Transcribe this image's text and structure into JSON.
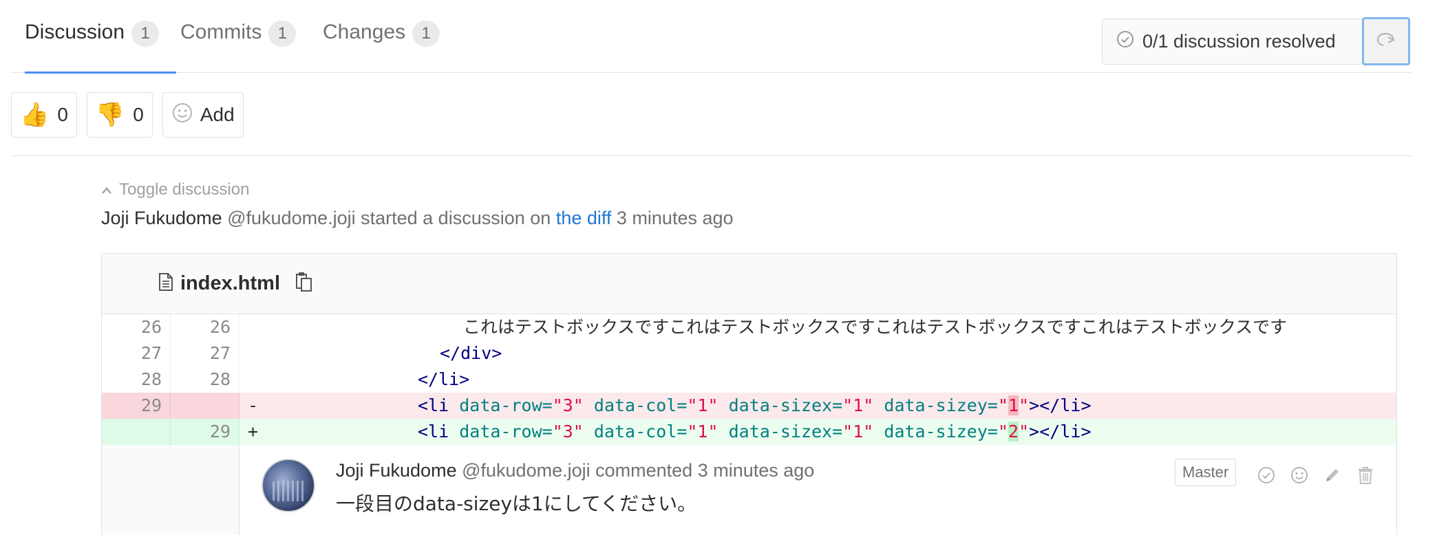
{
  "tabs": [
    {
      "label": "Discussion",
      "count": "1",
      "active": true
    },
    {
      "label": "Commits",
      "count": "1",
      "active": false
    },
    {
      "label": "Changes",
      "count": "1",
      "active": false
    }
  ],
  "resolved": {
    "text": "0/1 discussion resolved",
    "icon": "check-circle-icon"
  },
  "jump_button": {
    "icon": "comment-arrow-icon"
  },
  "awards": [
    {
      "emoji": "👍",
      "icon": "thumbs-up-icon",
      "count": "0"
    },
    {
      "emoji": "👎",
      "icon": "thumbs-down-icon",
      "count": "0"
    },
    {
      "icon": "smiley-icon",
      "label": "Add"
    }
  ],
  "discussion": {
    "toggle_label": "Toggle discussion",
    "author": "Joji Fukudome",
    "handle": "@fukudome.joji",
    "action": "started a discussion on",
    "link": "the diff",
    "time": "3 minutes ago"
  },
  "file": {
    "name": "index.html",
    "lines": [
      {
        "old": "26",
        "new": "26",
        "sign": "",
        "text": "これはテストボックスですこれはテストボックスですこれはテストボックスですこれはテストボックスです"
      },
      {
        "old": "27",
        "new": "27",
        "sign": "",
        "text": "</div>"
      },
      {
        "old": "28",
        "new": "28",
        "sign": "",
        "text": "</li>"
      },
      {
        "old": "29",
        "new": "",
        "sign": "-",
        "text": "<li data-row=\"3\" data-col=\"1\" data-sizex=\"1\" data-sizey=\"1\"></li>"
      },
      {
        "old": "",
        "new": "29",
        "sign": "+",
        "text": "<li data-row=\"3\" data-col=\"1\" data-sizex=\"1\" data-sizey=\"2\"></li>"
      }
    ]
  },
  "note": {
    "author": "Joji Fukudome",
    "handle": "@fukudome.joji",
    "action": "commented",
    "time": "3 minutes ago",
    "role": "Master",
    "body": "一段目のdata-sizeyは1にしてください。",
    "actions": [
      "resolve-icon",
      "add-reaction-icon",
      "edit-icon",
      "delete-icon"
    ]
  },
  "colors": {
    "accent": "#4a8bee",
    "link": "#1f78d1",
    "removed_bg": "#fbe9eb",
    "added_bg": "#ecfdf0"
  }
}
